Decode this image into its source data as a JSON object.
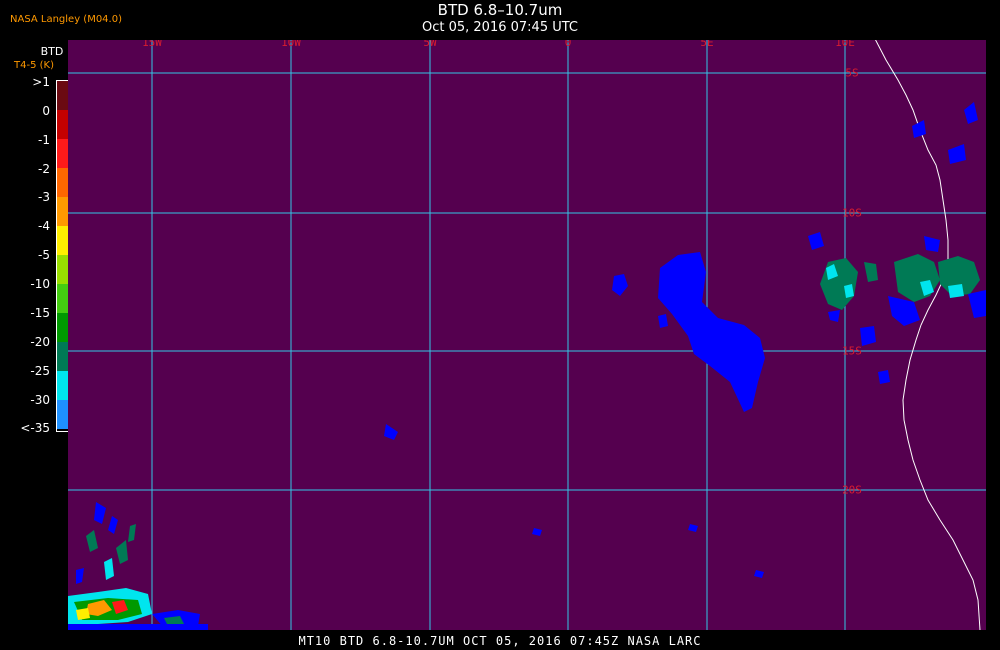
{
  "header": {
    "producer": "NASA Langley (M04.0)",
    "title": "BTD 6.8–10.7um",
    "subtitle": "Oct 05, 2016 07:45 UTC"
  },
  "footer": {
    "caption": "MT10  BTD 6.8-10.7UM   OCT 05, 2016 07:45Z  NASA LARC"
  },
  "colorbar": {
    "title": "BTD",
    "unit": "T4-5 (K)",
    "ticks": [
      ">1",
      "0",
      "-1",
      "-2",
      "-3",
      "-4",
      "-5",
      "-10",
      "-15",
      "-20",
      "-25",
      "-30",
      "<-35"
    ],
    "colors": [
      "#6b0a12",
      "#c40000",
      "#ff1a1a",
      "#ff6600",
      "#ff9900",
      "#ffee00",
      "#99dd00",
      "#44cc11",
      "#009900",
      "#007a55",
      "#00e5ee",
      "#1e90ff",
      "#0000ff",
      "#55004f"
    ]
  },
  "map": {
    "background": "#55004f",
    "grid_color": "#33c6e6",
    "coast_color": "#ffffff",
    "lon_labels": [
      "15W",
      "10W",
      "5W",
      "0",
      "5E",
      "10E"
    ],
    "lat_labels": [
      "5S",
      "10S",
      "15S",
      "20S"
    ]
  }
}
